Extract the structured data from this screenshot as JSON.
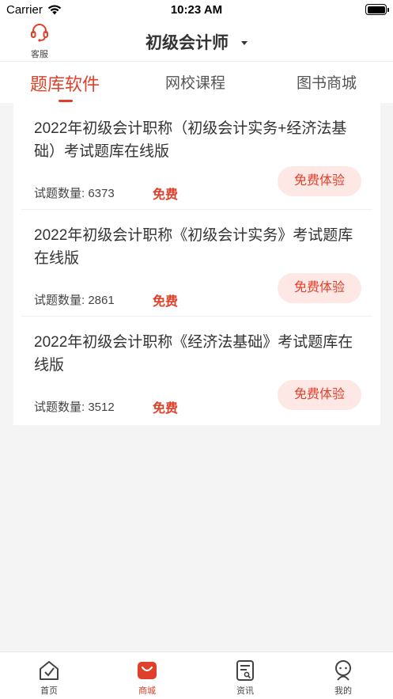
{
  "status_bar": {
    "carrier": "Carrier",
    "time": "10:23 AM"
  },
  "header": {
    "service_label": "客服",
    "title": "初级会计师"
  },
  "tabs": [
    {
      "label": "题库软件",
      "active": true
    },
    {
      "label": "网校课程",
      "active": false
    },
    {
      "label": "图书商城",
      "active": false
    }
  ],
  "products": [
    {
      "title": "2022年初级会计职称（初级会计实务+经济法基础）考试题库在线版",
      "count_label": "试题数量: ",
      "count": "6373",
      "price": "免费",
      "button": "免费体验"
    },
    {
      "title": "2022年初级会计职称《初级会计实务》考试题库在线版",
      "count_label": "试题数量: ",
      "count": "2861",
      "price": "免费",
      "button": "免费体验"
    },
    {
      "title": "2022年初级会计职称《经济法基础》考试题库在线版",
      "count_label": "试题数量: ",
      "count": "3512",
      "price": "免费",
      "button": "免费体验"
    }
  ],
  "tabbar": [
    {
      "label": "首页",
      "icon": "home-icon",
      "active": false
    },
    {
      "label": "商城",
      "icon": "mall-bag-icon",
      "active": true
    },
    {
      "label": "资讯",
      "icon": "news-icon",
      "active": false
    },
    {
      "label": "我的",
      "icon": "profile-icon",
      "active": false
    }
  ],
  "colors": {
    "accent": "#e0402a",
    "button_bg": "#fde8e6",
    "page_bg": "#f4f4f4"
  }
}
